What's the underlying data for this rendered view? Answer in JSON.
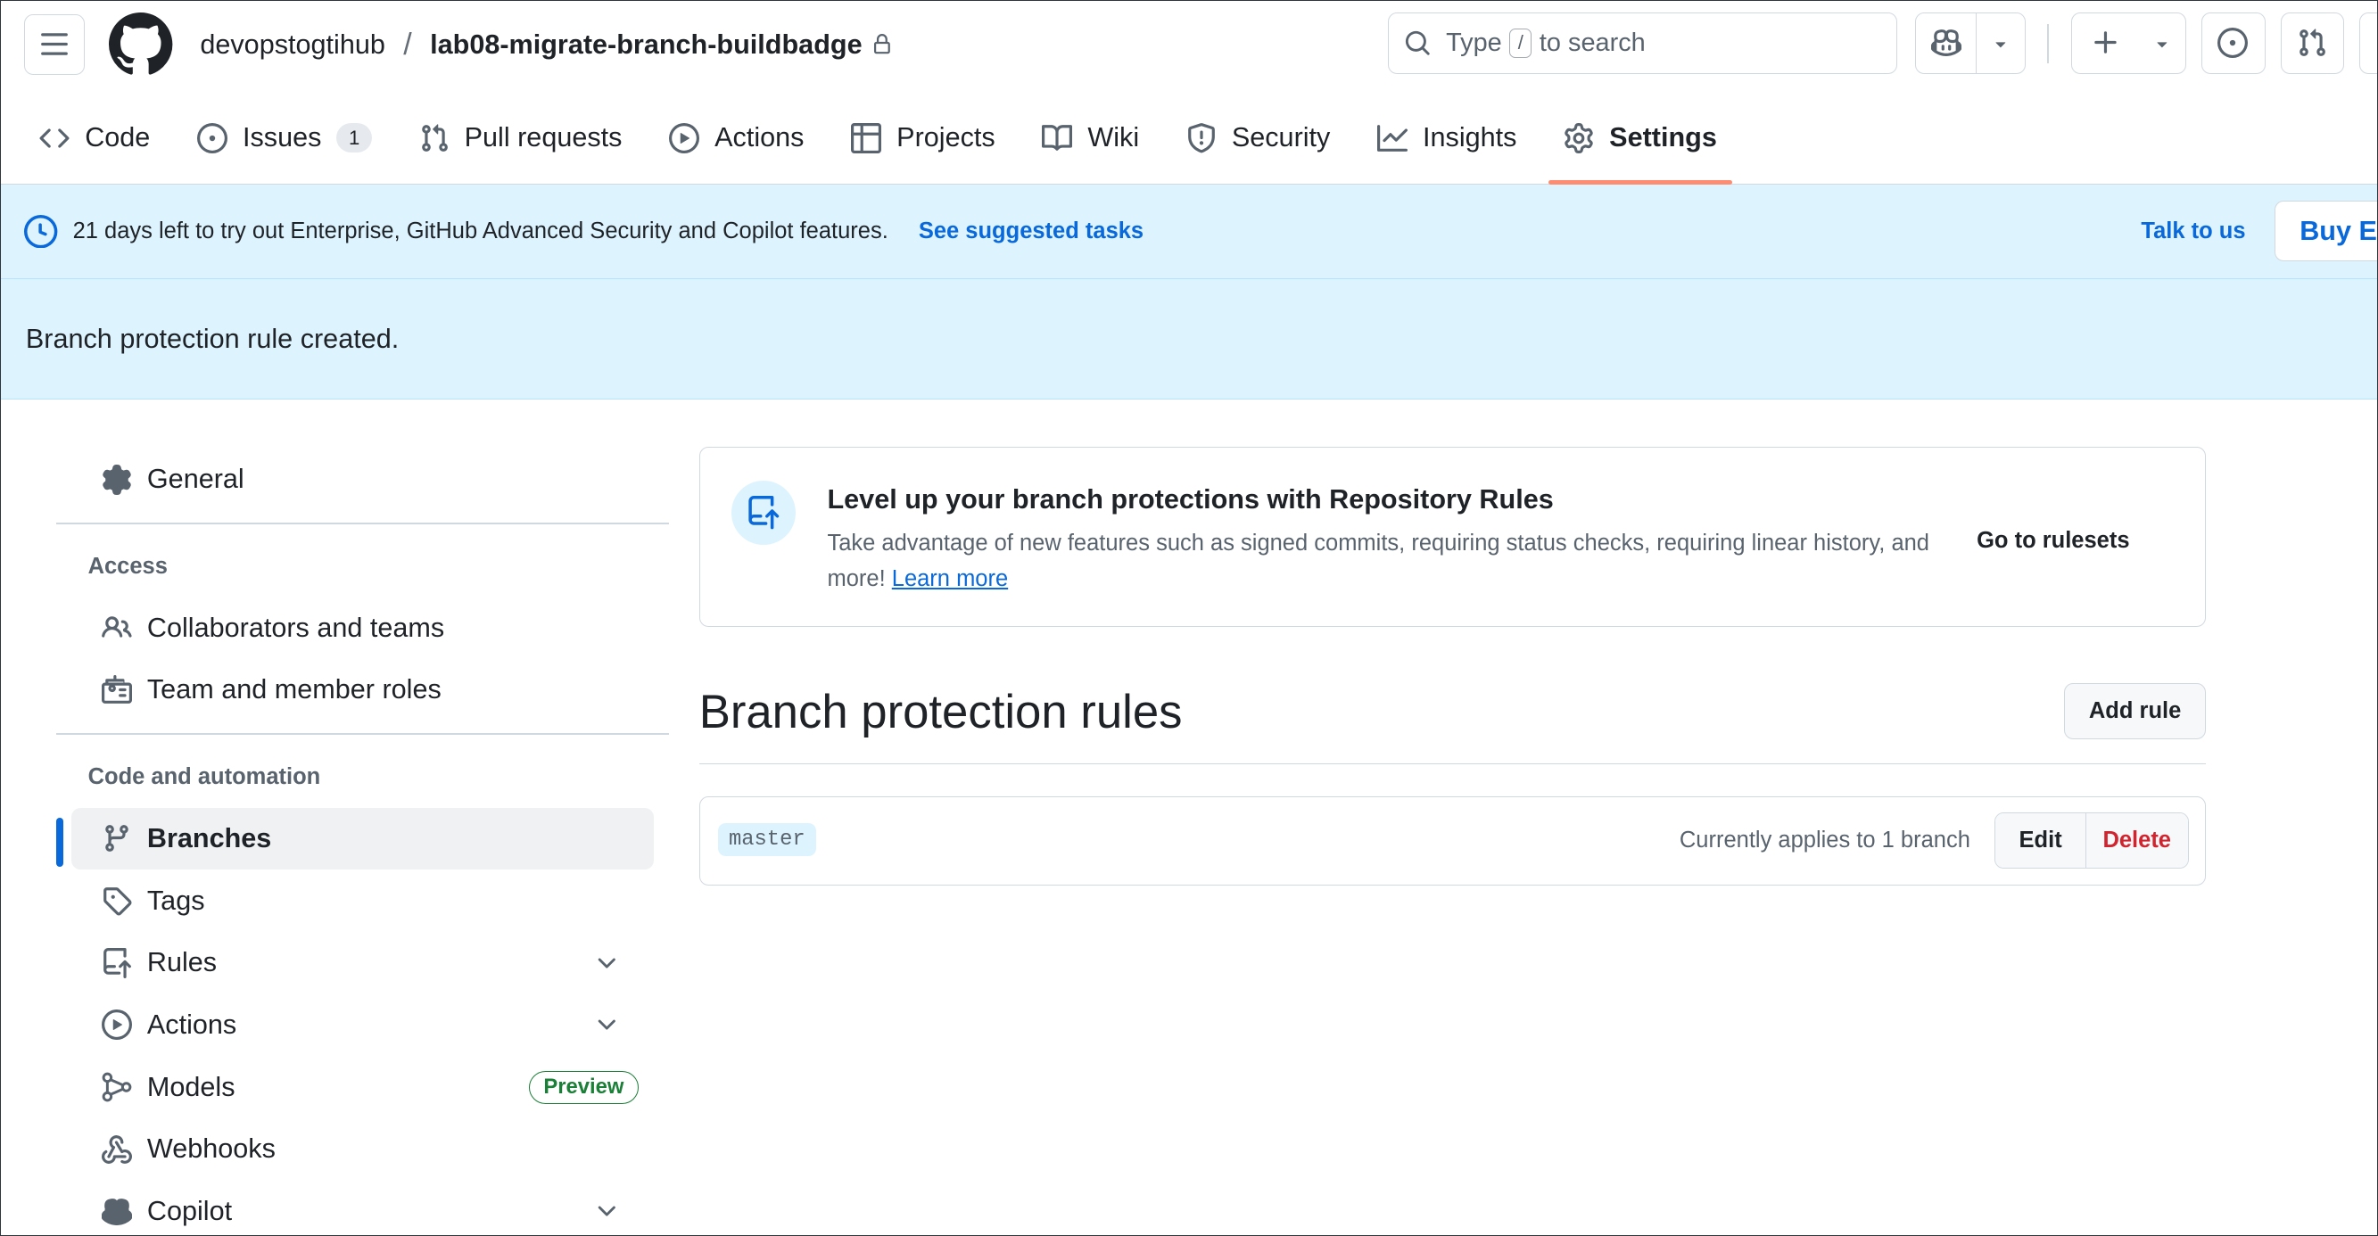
{
  "header": {
    "owner": "devopstogtihub",
    "separator": "/",
    "repo": "lab08-migrate-branch-buildbadge",
    "search_prefix": "Type",
    "search_key": "/",
    "search_suffix": "to search"
  },
  "repo_nav": {
    "tabs": [
      {
        "label": "Code"
      },
      {
        "label": "Issues",
        "counter": "1"
      },
      {
        "label": "Pull requests"
      },
      {
        "label": "Actions"
      },
      {
        "label": "Projects"
      },
      {
        "label": "Wiki"
      },
      {
        "label": "Security"
      },
      {
        "label": "Insights"
      },
      {
        "label": "Settings",
        "active": true
      }
    ]
  },
  "trial_banner": {
    "message": "21 days left to try out Enterprise, GitHub Advanced Security and Copilot features.",
    "link": "See suggested tasks",
    "talk": "Talk to us",
    "buy": "Buy Enterprise"
  },
  "flash": {
    "message": "Branch protection rule created."
  },
  "sidebar": {
    "general": "General",
    "access_heading": "Access",
    "collaborators": "Collaborators and teams",
    "team_roles": "Team and member roles",
    "code_heading": "Code and automation",
    "branches": "Branches",
    "tags": "Tags",
    "rules": "Rules",
    "actions": "Actions",
    "models": "Models",
    "models_badge": "Preview",
    "webhooks": "Webhooks",
    "copilot": "Copilot"
  },
  "promo": {
    "title": "Level up your branch protections with Repository Rules",
    "desc": "Take advantage of new features such as signed commits, requiring status checks, requiring linear history, and more!",
    "learn_more": "Learn more",
    "goto": "Go to rulesets"
  },
  "branch_rules": {
    "heading": "Branch protection rules",
    "add_rule": "Add rule",
    "rules": [
      {
        "branch": "master",
        "applies": "Currently applies to 1 branch",
        "edit": "Edit",
        "delete": "Delete"
      }
    ]
  },
  "colors": {
    "accent": "#0969da",
    "active_tab_underline": "#fd8c73",
    "banner_bg": "#ddf4ff",
    "danger": "#d1242f",
    "success": "#1a7f37"
  }
}
